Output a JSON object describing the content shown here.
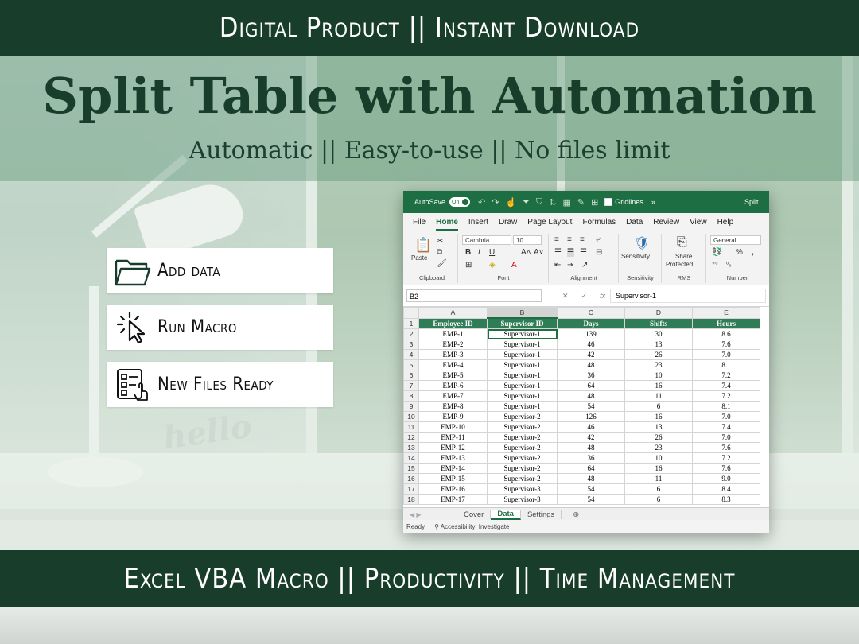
{
  "banner_top": "Digital Product || Instant Download",
  "title": "Split Table with Automation",
  "subtitle": "Automatic || Easy-to-use || No files limit",
  "steps": [
    {
      "label": "Add data",
      "icon": "folder-icon"
    },
    {
      "label": "Run Macro",
      "icon": "cursor-click-icon"
    },
    {
      "label": "New Files Ready",
      "icon": "checklist-icon"
    }
  ],
  "banner_bottom": "Excel VBA Macro || Productivity || Time Management",
  "background_text": "hello",
  "colors": {
    "brand_dark": "#183d2b",
    "excel_green": "#1e6e43",
    "header_fill": "#2e7d57"
  },
  "excel": {
    "autosave_label": "AutoSave",
    "autosave_state": "On",
    "gridlines_label": "Gridlines",
    "title_truncated": "Split...",
    "menu": [
      "File",
      "Home",
      "Insert",
      "Draw",
      "Page Layout",
      "Formulas",
      "Data",
      "Review",
      "View",
      "Help"
    ],
    "active_menu": "Home",
    "ribbon": {
      "paste": "Paste",
      "font_name": "Cambria",
      "font_size": "10",
      "number_format": "General",
      "sensitivity": "Sensitivity",
      "share_protected_1": "Share",
      "share_protected_2": "Protected",
      "groups": {
        "clipboard": "Clipboard",
        "font": "Font",
        "alignment": "Alignment",
        "sensitivity": "Sensitivity",
        "rms": "RMS",
        "number": "Number"
      }
    },
    "name_box": "B2",
    "formula_value": "Supervisor-1",
    "column_letters": [
      "A",
      "B",
      "C",
      "D",
      "E"
    ],
    "headers": [
      "Employee ID",
      "Supervisor ID",
      "Days",
      "Shifts",
      "Hours"
    ],
    "rows": [
      [
        "EMP-1",
        "Supervisor-1",
        "139",
        "30",
        "8.6"
      ],
      [
        "EMP-2",
        "Supervisor-1",
        "46",
        "13",
        "7.6"
      ],
      [
        "EMP-3",
        "Supervisor-1",
        "42",
        "26",
        "7.0"
      ],
      [
        "EMP-4",
        "Supervisor-1",
        "48",
        "23",
        "8.1"
      ],
      [
        "EMP-5",
        "Supervisor-1",
        "36",
        "10",
        "7.2"
      ],
      [
        "EMP-6",
        "Supervisor-1",
        "64",
        "16",
        "7.4"
      ],
      [
        "EMP-7",
        "Supervisor-1",
        "48",
        "11",
        "7.2"
      ],
      [
        "EMP-8",
        "Supervisor-1",
        "54",
        "6",
        "8.1"
      ],
      [
        "EMP-9",
        "Supervisor-2",
        "126",
        "16",
        "7.0"
      ],
      [
        "EMP-10",
        "Supervisor-2",
        "46",
        "13",
        "7.4"
      ],
      [
        "EMP-11",
        "Supervisor-2",
        "42",
        "26",
        "7.0"
      ],
      [
        "EMP-12",
        "Supervisor-2",
        "48",
        "23",
        "7.6"
      ],
      [
        "EMP-13",
        "Supervisor-2",
        "36",
        "10",
        "7.2"
      ],
      [
        "EMP-14",
        "Supervisor-2",
        "64",
        "16",
        "7.6"
      ],
      [
        "EMP-15",
        "Supervisor-2",
        "48",
        "11",
        "9.0"
      ],
      [
        "EMP-16",
        "Supervisor-3",
        "54",
        "6",
        "8.4"
      ],
      [
        "EMP-17",
        "Supervisor-3",
        "54",
        "6",
        "8.3"
      ]
    ],
    "sheet_tabs": [
      "Cover",
      "Data",
      "Settings"
    ],
    "active_sheet": "Data",
    "status_ready": "Ready",
    "status_accessibility": "Accessibility: Investigate"
  }
}
